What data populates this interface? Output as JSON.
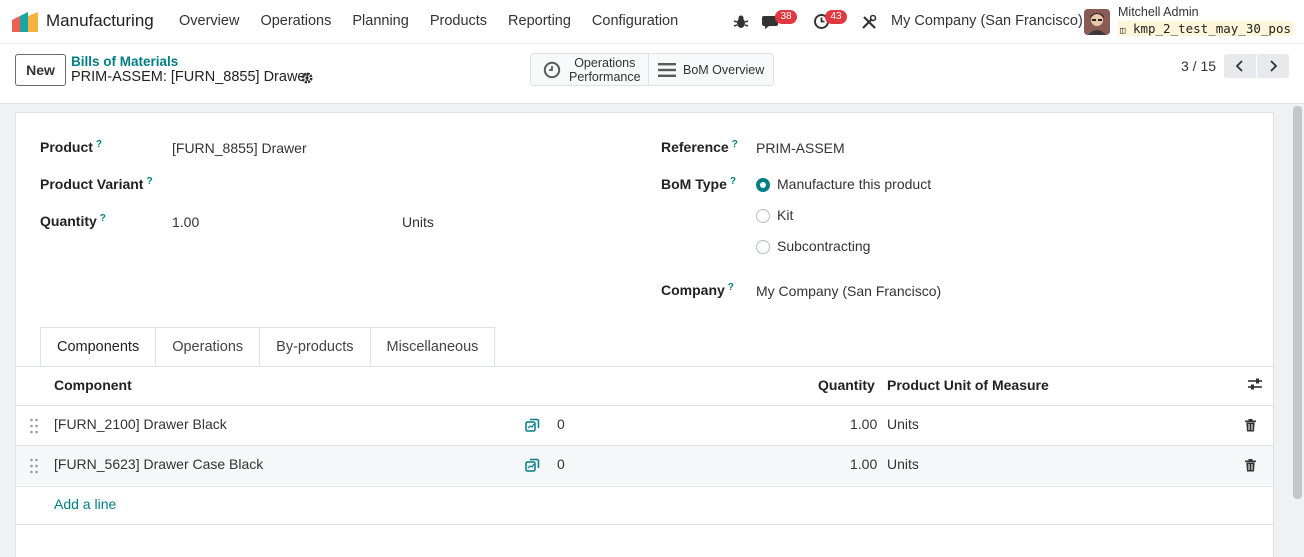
{
  "navbar": {
    "app_name": "Manufacturing",
    "menu": [
      "Overview",
      "Operations",
      "Planning",
      "Products",
      "Reporting",
      "Configuration"
    ],
    "messages_count": "38",
    "activities_count": "43",
    "company": "My Company (San Francisco)",
    "user_name": "Mitchell Admin",
    "database": "kmp_2_test_may_30_pos"
  },
  "control": {
    "new_label": "New",
    "breadcrumb_parent": "Bills of Materials",
    "breadcrumb_current": "PRIM-ASSEM: [FURN_8855] Drawer",
    "smart_buttons": [
      {
        "line1": "Operations",
        "line2": "Performance",
        "icon": "clock-icon"
      },
      {
        "label": "BoM Overview",
        "icon": "bars-icon"
      }
    ],
    "pager": "3 / 15"
  },
  "form": {
    "product_label": "Product",
    "product_value": "[FURN_8855] Drawer",
    "variant_label": "Product Variant",
    "quantity_label": "Quantity",
    "quantity_value": "1.00",
    "quantity_uom": "Units",
    "reference_label": "Reference",
    "reference_value": "PRIM-ASSEM",
    "bom_type_label": "BoM Type",
    "bom_types": [
      "Manufacture this product",
      "Kit",
      "Subcontracting"
    ],
    "bom_type_selected": "Manufacture this product",
    "company_label": "Company",
    "company_value": "My Company (San Francisco)",
    "help_mark": "?"
  },
  "tabs": [
    "Components",
    "Operations",
    "By-products",
    "Miscellaneous"
  ],
  "table": {
    "headers": {
      "component": "Component",
      "quantity": "Quantity",
      "uom": "Product Unit of Measure"
    },
    "rows": [
      {
        "component": "[FURN_2100] Drawer Black",
        "forecast": "0",
        "quantity": "1.00",
        "uom": "Units"
      },
      {
        "component": "[FURN_5623] Drawer Case Black",
        "forecast": "0",
        "quantity": "1.00",
        "uom": "Units"
      }
    ],
    "add_line": "Add a line"
  },
  "colors": {
    "accent": "#017e84",
    "badge": "#e2383f"
  }
}
